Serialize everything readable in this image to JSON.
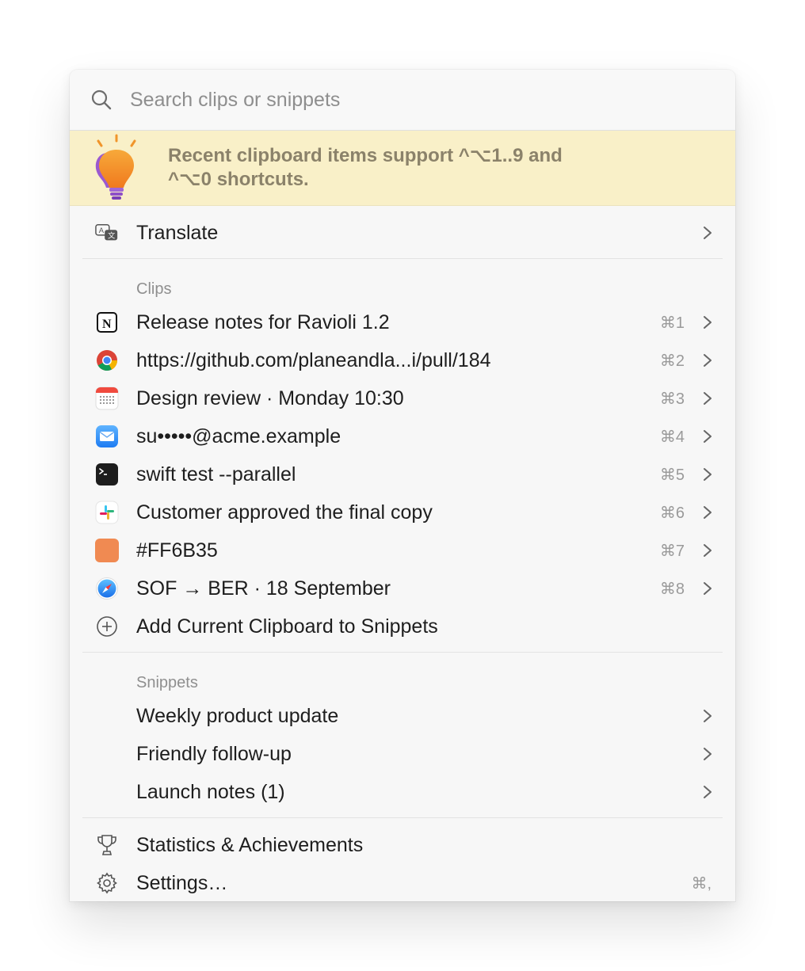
{
  "search": {
    "placeholder": "Search clips or snippets",
    "icon": "search-icon"
  },
  "tip": {
    "line1": "Recent clipboard items support ^⌥1..9 and",
    "line2": "^⌥0 shortcuts.",
    "icon": "lightbulb-icon"
  },
  "translate": {
    "label": "Translate",
    "icon": "translate-icon"
  },
  "clips": {
    "header": "Clips",
    "items": [
      {
        "label": "Release notes for Ravioli 1.2",
        "shortcut": "⌘1",
        "icon": "notion-icon"
      },
      {
        "label": "https://github.com/planeandla...i/pull/184",
        "shortcut": "⌘2",
        "icon": "chrome-icon"
      },
      {
        "label": "Design review · Monday 10:30",
        "shortcut": "⌘3",
        "icon": "calendar-icon"
      },
      {
        "label": "su•••••@acme.example",
        "shortcut": "⌘4",
        "icon": "mail-icon"
      },
      {
        "label": "swift test --parallel",
        "shortcut": "⌘5",
        "icon": "terminal-icon"
      },
      {
        "label": "Customer approved the final copy",
        "shortcut": "⌘6",
        "icon": "slack-icon"
      },
      {
        "label": "#FF6B35",
        "shortcut": "⌘7",
        "icon": "color-swatch-icon",
        "color": "#f08a52"
      },
      {
        "label": "SOF → BER · 18 September",
        "shortcut": "⌘8",
        "icon": "safari-icon"
      }
    ],
    "add_label": "Add Current Clipboard to Snippets"
  },
  "snippets": {
    "header": "Snippets",
    "items": [
      {
        "label": "Weekly product update"
      },
      {
        "label": "Friendly follow-up"
      },
      {
        "label": "Launch notes (1)"
      }
    ]
  },
  "footer": {
    "stats_label": "Statistics & Achievements",
    "settings_label": "Settings…",
    "settings_shortcut": "⌘,"
  },
  "colors": {
    "tip_bg": "#f9f0c8",
    "tip_text": "#8b826a",
    "panel_bg": "#f7f7f7"
  }
}
